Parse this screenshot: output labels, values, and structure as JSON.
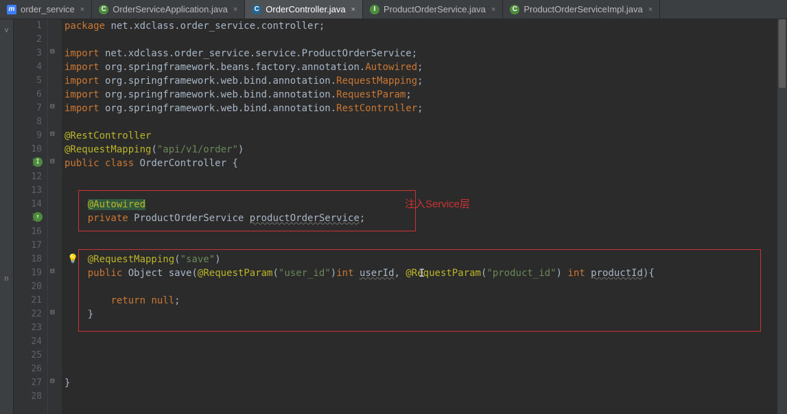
{
  "tabs": [
    {
      "label": "order_service",
      "icon": "m",
      "iconText": "m",
      "active": false
    },
    {
      "label": "OrderServiceApplication.java",
      "icon": "c",
      "iconText": "C",
      "active": false
    },
    {
      "label": "OrderController.java",
      "icon": "c-active",
      "iconText": "C",
      "active": true
    },
    {
      "label": "ProductOrderService.java",
      "icon": "i",
      "iconText": "I",
      "active": false
    },
    {
      "label": "ProductOrderServiceImpl.java",
      "icon": "c",
      "iconText": "C",
      "active": false
    }
  ],
  "annotation": {
    "label": "注入Service层"
  },
  "sidebar": {
    "letter1": "v",
    "letter2": "n"
  },
  "code": {
    "l1": {
      "pkg": "package",
      "path": " net.xdclass.order_service.controller;"
    },
    "l3": {
      "imp": "import",
      "path": " net.xdclass.order_service.service.ProductOrderService;"
    },
    "l4": {
      "imp": "import",
      "path1": " org.springframework.beans.factory.annotation.",
      "cls": "Autowired",
      "end": ";"
    },
    "l5": {
      "imp": "import",
      "path1": " org.springframework.web.bind.annotation.",
      "cls": "RequestMapping",
      "end": ";"
    },
    "l6": {
      "imp": "import",
      "path1": " org.springframework.web.bind.annotation.",
      "cls": "RequestParam",
      "end": ";"
    },
    "l7": {
      "imp": "import",
      "path1": " org.springframework.web.bind.annotation.",
      "cls": "RestController",
      "end": ";"
    },
    "l9": {
      "anno": "@RestController"
    },
    "l10": {
      "anno": "@RequestMapping",
      "paren1": "(",
      "str": "\"api/v1/order\"",
      "paren2": ")"
    },
    "l11": {
      "pub": "public class ",
      "name": "OrderController {"
    },
    "l14": {
      "indent": "    ",
      "anno": "@Autowired"
    },
    "l15": {
      "indent": "    ",
      "priv": "private ",
      "type": "ProductOrderService ",
      "name": "productOrderService",
      "end": ";"
    },
    "l18": {
      "indent": "    ",
      "anno": "@RequestMapping",
      "paren1": "(",
      "str": "\"save\"",
      "paren2": ")"
    },
    "l19": {
      "indent": "    ",
      "pub": "public ",
      "type": "Object ",
      "method": "save(",
      "anno1": "@RequestParam",
      "p1a": "(",
      "str1": "\"user_id\"",
      "p1b": ")",
      "int1": "int ",
      "arg1": "userId",
      "comma": ", ",
      "anno2": "@RequestParam",
      "p2a": "(",
      "str2": "\"product_id\"",
      "p2b": ") ",
      "int2": "int ",
      "arg2": "productId",
      "end": "){"
    },
    "l21": {
      "indent": "        ",
      "ret": "return null",
      "end": ";"
    },
    "l22": {
      "indent": "    ",
      "brace": "}"
    },
    "l27": {
      "brace": "}"
    }
  },
  "line_count": 28
}
